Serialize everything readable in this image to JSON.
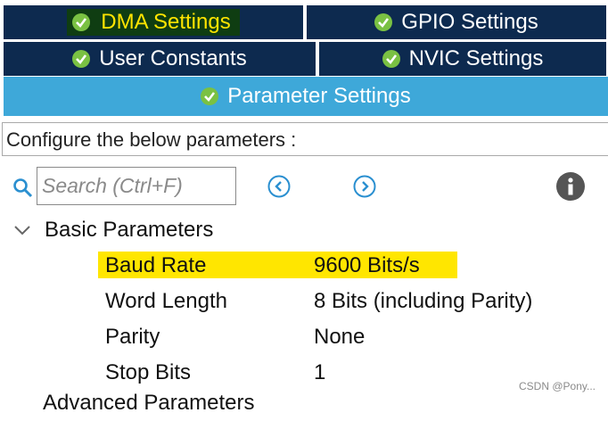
{
  "tabs": {
    "dma": "DMA Settings",
    "gpio": "GPIO Settings",
    "user_constants": "User Constants",
    "nvic": "NVIC Settings",
    "parameter": "Parameter Settings"
  },
  "configure_text": "Configure the below parameters :",
  "search": {
    "placeholder": "Search (Ctrl+F)"
  },
  "section": {
    "basic": "Basic Parameters",
    "advanced": "Advanced Parameters"
  },
  "parameters": [
    {
      "name": "Baud Rate",
      "value": "9600 Bits/s"
    },
    {
      "name": "Word Length",
      "value": "8 Bits (including Parity)"
    },
    {
      "name": "Parity",
      "value": "None"
    },
    {
      "name": "Stop Bits",
      "value": "1"
    }
  ],
  "watermark": "CSDN @Pony...",
  "colors": {
    "tab_bg": "#0d2a4f",
    "tab_active_bg": "#3ea8d9",
    "highlight": "#ffe600",
    "check_icon": "#7ac143"
  }
}
